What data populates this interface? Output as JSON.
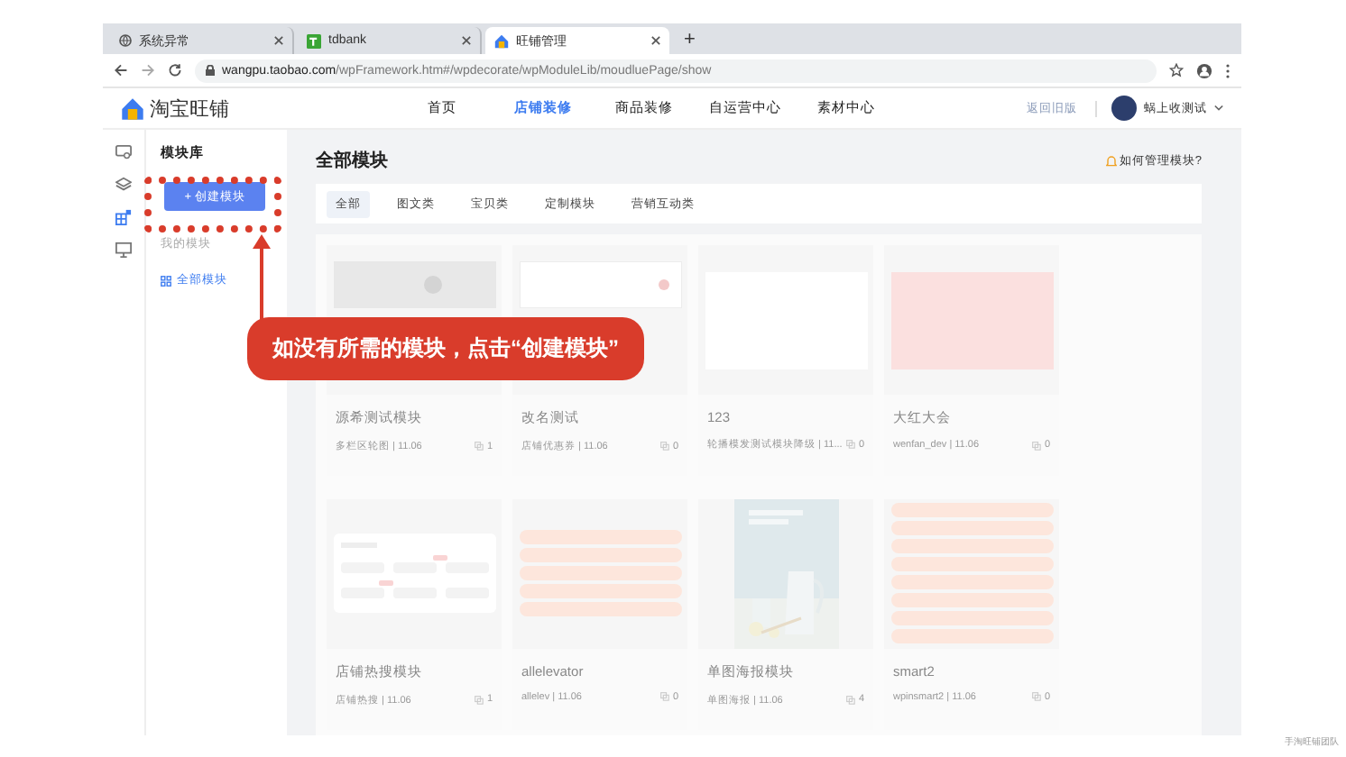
{
  "browser": {
    "tabs": [
      {
        "title": "系统异常",
        "kind": "globe",
        "selected": false
      },
      {
        "title": "tdbank",
        "kind": "td",
        "selected": false
      },
      {
        "title": "旺铺管理",
        "kind": "shop",
        "selected": true
      }
    ],
    "new_tab": "+",
    "url_host": "wangpu.taobao.com",
    "url_path": "/wpFramework.htm#/wpdecorate/wpModuleLib/moudluePage/show"
  },
  "site": {
    "logo": "淘宝旺铺",
    "nav": [
      {
        "label": "首页",
        "selected": false
      },
      {
        "label": "店铺装修",
        "selected": true
      },
      {
        "label": "商品装修",
        "selected": false
      },
      {
        "label": "自运营中心",
        "selected": false
      },
      {
        "label": "素材中心",
        "selected": false
      }
    ],
    "back_link": "返回旧版",
    "user": "蜗上收测试"
  },
  "sidebar": {
    "title": "模块库",
    "create_button": "+ 创建模块",
    "section": "我的模块",
    "items": [
      {
        "label": "全部模块",
        "selected": true
      }
    ]
  },
  "main": {
    "title": "全部模块",
    "help_link": "如何管理模块?",
    "filters": [
      {
        "label": "全部",
        "selected": true
      },
      {
        "label": "图文类",
        "selected": false
      },
      {
        "label": "宝贝类",
        "selected": false
      },
      {
        "label": "定制模块",
        "selected": false
      },
      {
        "label": "营销互动类",
        "selected": false
      }
    ],
    "modules": [
      {
        "name": "源希测试模块",
        "meta": "多栏区轮图 | 11.06",
        "count": "1",
        "kind": "carousel"
      },
      {
        "name": "改名测试",
        "meta": "店铺优惠券 | 11.06",
        "count": "0",
        "kind": "coupon"
      },
      {
        "name": "123",
        "meta": "轮播模发测试模块降级 | 11...",
        "count": "0",
        "kind": "blank"
      },
      {
        "name": "大红大会",
        "meta": "wenfan_dev | 11.06",
        "count": "0",
        "kind": "pink"
      },
      {
        "name": "店铺热搜模块",
        "meta": "店铺热搜 | 11.06",
        "count": "1",
        "kind": "tags"
      },
      {
        "name": "allelevator",
        "meta": "allelev | 11.06",
        "count": "0",
        "kind": "pills5"
      },
      {
        "name": "单图海报模块",
        "meta": "单图海报 | 11.06",
        "count": "4",
        "kind": "poster"
      },
      {
        "name": "smart2",
        "meta": "wpinsmart2 | 11.06",
        "count": "0",
        "kind": "pills8"
      }
    ]
  },
  "callout": "如没有所需的模块，点击“创建模块”",
  "footer": "手淘旺铺团队"
}
